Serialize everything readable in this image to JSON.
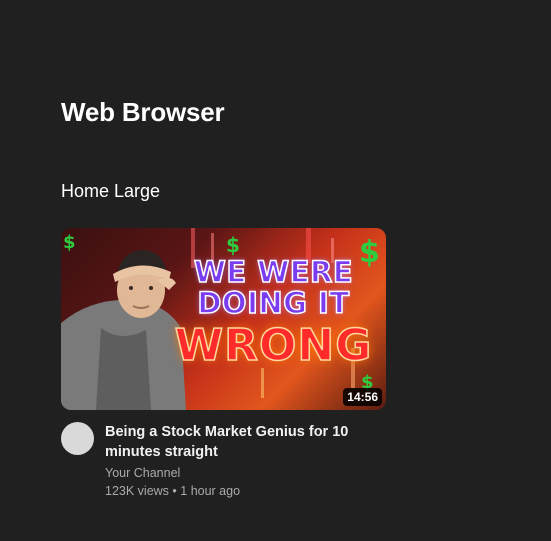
{
  "page": {
    "title": "Web Browser"
  },
  "section": {
    "title": "Home Large"
  },
  "video": {
    "thumbnail_text": {
      "line1": "WE WERE",
      "line2": "DOING IT",
      "line3": "WRONG"
    },
    "duration": "14:56",
    "title": "Being a Stock Market Genius for 10 minutes straight",
    "channel": "Your Channel",
    "views": "123K views",
    "separator": " • ",
    "age": "1 hour ago"
  },
  "colors": {
    "background": "#202020",
    "avatar": "#d9d9d9",
    "secondary_text": "#aaaaaa"
  }
}
